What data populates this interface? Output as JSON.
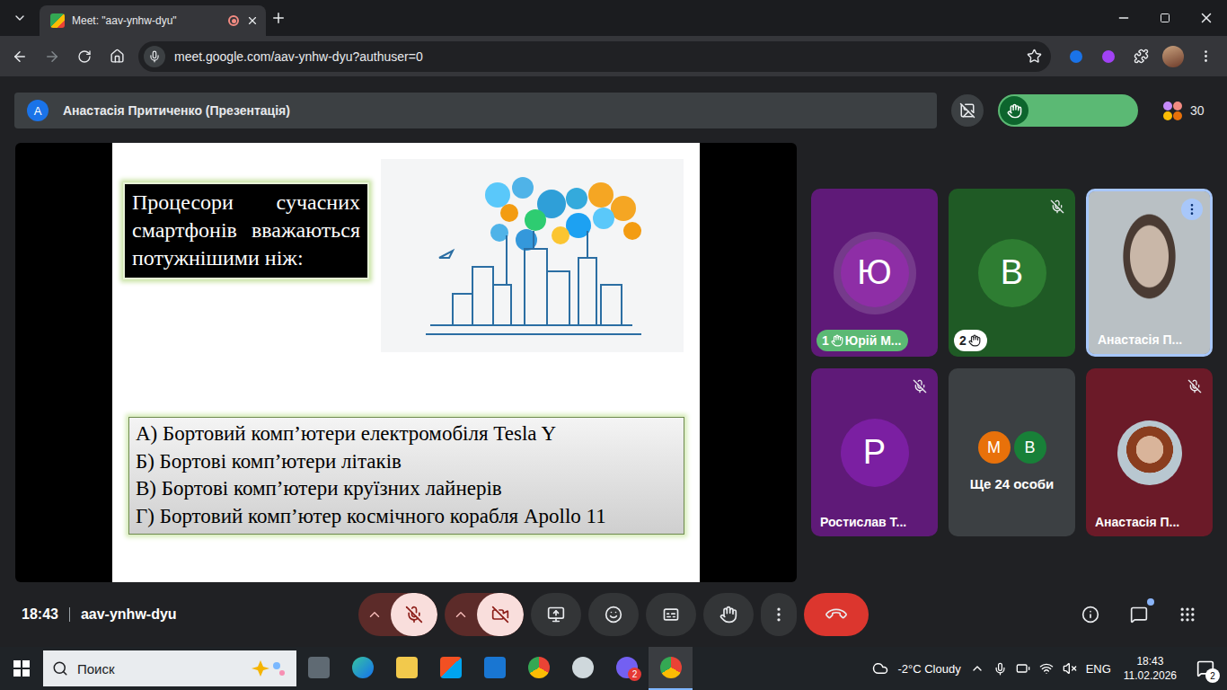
{
  "browser": {
    "tab_title": "Meet: \"aav-ynhw-dyu\"",
    "recording": true,
    "url": "meet.google.com/aav-ynhw-dyu?authuser=0"
  },
  "meeting": {
    "presenter_banner": {
      "avatar": "А",
      "text": "Анастасія Притиченко (Презентація)"
    },
    "hands_raised": true,
    "participant_count": "30",
    "slide": {
      "question": "Процесори сучасних смартфонів вважаються потужнішими ніж:",
      "answers": [
        "А) Бортовий комп’ютери електромобіля Tesla Y",
        "Б) Бортові комп’ютери літаків",
        "В) Бортові комп’ютери круїзних лайнерів",
        "Г) Бортовий комп’ютер космічного корабля Apollo 11"
      ]
    },
    "tiles": [
      {
        "kind": "avatar",
        "avatar": "Ю",
        "name": "Юрій М...",
        "hand": "1",
        "muted": false,
        "highlighted": false,
        "color": "#5f1a78",
        "avatar_color": "#8e2ea6"
      },
      {
        "kind": "avatar",
        "avatar": "В",
        "hand": "2",
        "muted": true,
        "highlighted": false,
        "color": "#1f5a25",
        "avatar_color": "#2e7d32"
      },
      {
        "kind": "video",
        "name": "Анастасія П...",
        "muted": false,
        "highlighted": true,
        "color": "#8a8f94"
      },
      {
        "kind": "avatar",
        "avatar": "Р",
        "name": "Ростислав Т...",
        "muted": true,
        "highlighted": false,
        "color": "#5f1a78",
        "avatar_color": "#7b1fa2"
      },
      {
        "kind": "group",
        "name": "Ще 24 особи",
        "muted": false,
        "highlighted": false,
        "color": "#3c4043",
        "avatars": [
          {
            "letter": "М",
            "color": "#e8710a"
          },
          {
            "letter": "В",
            "color": "#188038"
          }
        ]
      },
      {
        "kind": "photo",
        "name": "Анастасія П...",
        "muted": true,
        "highlighted": false,
        "color": "#6b1a28"
      }
    ],
    "time": "18:43",
    "code": "aav-ynhw-dyu",
    "controls": {
      "mic_muted": true,
      "camera_off": true
    },
    "chat_unread": true
  },
  "taskbar": {
    "search_placeholder": "Поиск",
    "viber_badge": "2",
    "weather": "-2°C Cloudy",
    "language": "ENG",
    "time": "18:43",
    "date": "11.02.2026",
    "notifications": "2"
  }
}
